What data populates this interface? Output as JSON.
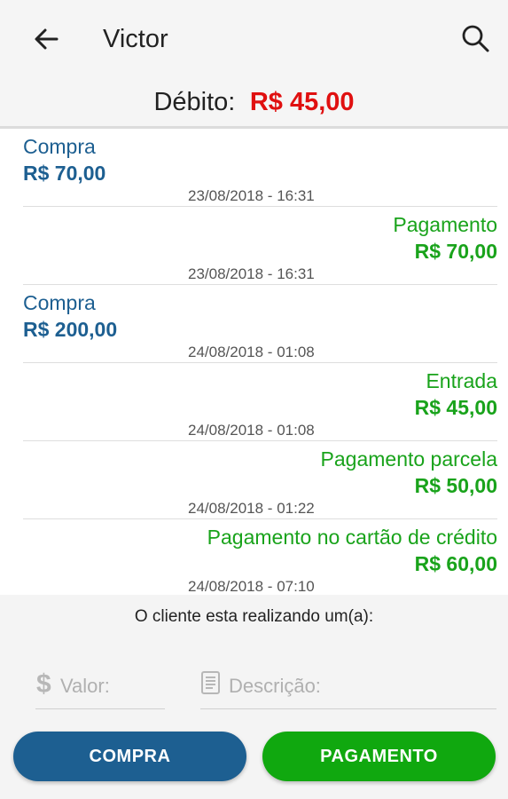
{
  "header": {
    "title": "Victor",
    "back_icon": "arrow-left-icon",
    "search_icon": "search-icon"
  },
  "debit": {
    "label": "Débito:",
    "value": "R$ 45,00",
    "value_color": "#e01010"
  },
  "transactions": [
    {
      "kind": "compra",
      "type": "Compra",
      "amount": "R$ 70,00",
      "date": "23/08/2018 - 16:31"
    },
    {
      "kind": "pagamento",
      "type": "Pagamento",
      "amount": "R$ 70,00",
      "date": "23/08/2018 - 16:31"
    },
    {
      "kind": "compra",
      "type": "Compra",
      "amount": "R$ 200,00",
      "date": "24/08/2018 - 01:08"
    },
    {
      "kind": "pagamento",
      "type": "Entrada",
      "amount": "R$ 45,00",
      "date": "24/08/2018 - 01:08"
    },
    {
      "kind": "pagamento",
      "type": "Pagamento parcela",
      "amount": "R$ 50,00",
      "date": "24/08/2018 - 01:22"
    },
    {
      "kind": "pagamento",
      "type": "Pagamento no cartão de crédito",
      "amount": "R$ 60,00",
      "date": "24/08/2018 - 07:10"
    }
  ],
  "form": {
    "prompt": "O cliente esta realizando um(a):",
    "valor": {
      "placeholder": "Valor:",
      "value": "",
      "icon": "dollar-icon"
    },
    "descricao": {
      "placeholder": "Descrição:",
      "value": "",
      "icon": "notepad-icon"
    }
  },
  "buttons": {
    "compra": "COMPRA",
    "pagamento": "PAGAMENTO"
  },
  "colors": {
    "compra": "#1d5f91",
    "pagamento": "#19a31b",
    "debit": "#e01010"
  }
}
